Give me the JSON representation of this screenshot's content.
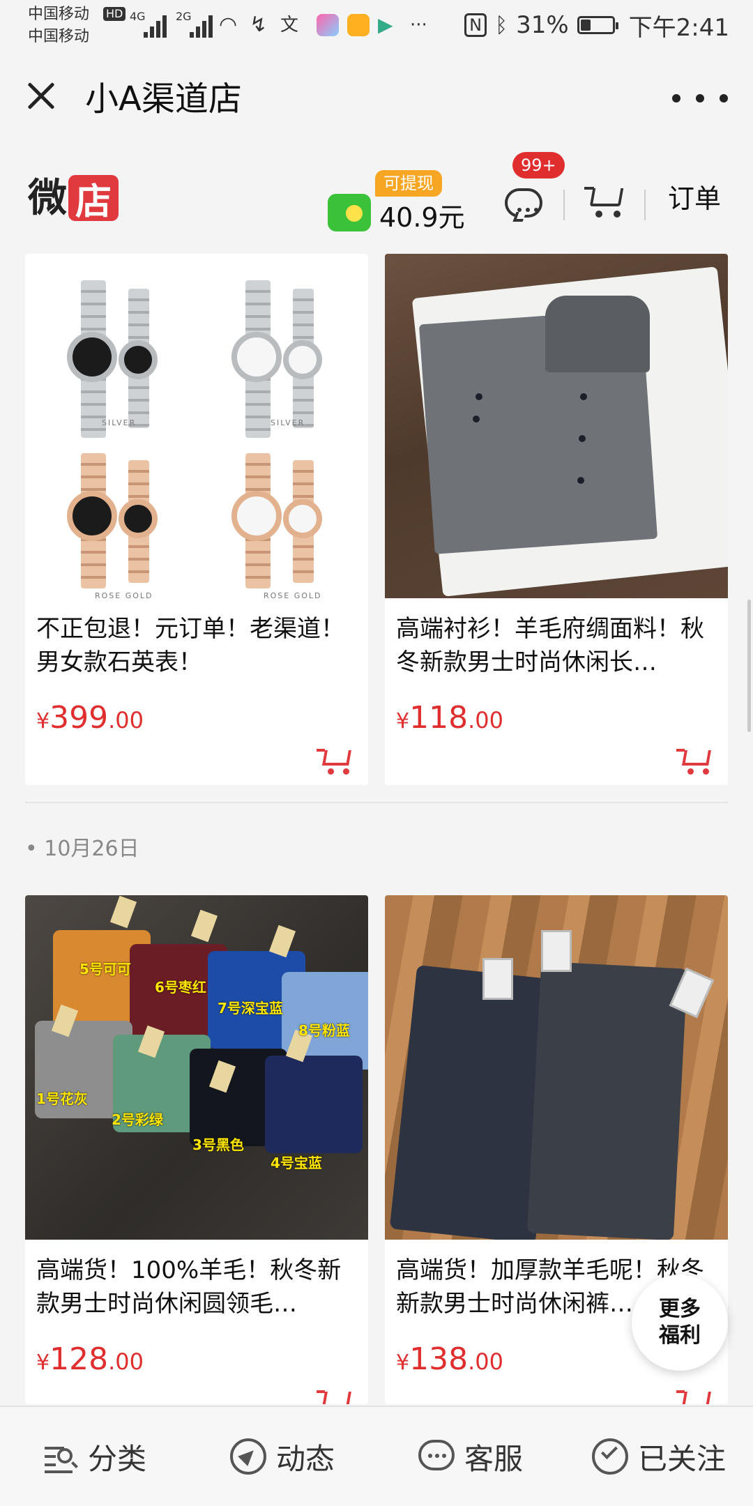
{
  "status_bar": {
    "carrier_1": "中国移动",
    "carrier_2": "中国移动",
    "hd": "HD",
    "net_1": "4G",
    "net_2": "2G",
    "nfc": "N",
    "battery_text": "31%",
    "battery_level": 0.31,
    "time": "下午2:41",
    "icons": [
      "wifi-icon",
      "missed-call-icon",
      "translate-icon",
      "app-icon",
      "app-icon",
      "play-icon",
      "more-notifications-icon",
      "nfc-icon",
      "bluetooth-icon",
      "battery-icon"
    ]
  },
  "title_bar": {
    "title": "小A渠道店"
  },
  "shop_header": {
    "logo_part1": "微",
    "logo_part2": "店",
    "withdraw_badge": "可提现",
    "balance": "40.9元",
    "message_count": "99+",
    "orders_label": "订单"
  },
  "products": [
    {
      "title": "不正包退！元订单！老渠道！男女款石英表！",
      "currency": "¥",
      "price_int": "399",
      "price_dec": ".00",
      "image": "watches-photo"
    },
    {
      "title": "高端衬衫！羊毛府绸面料！秋冬新款男士时尚休闲长…",
      "currency": "¥",
      "price_int": "118",
      "price_dec": ".00",
      "image": "shirts-photo"
    },
    {
      "title": "高端货！100%羊毛！秋冬新款男士时尚休闲圆领毛…",
      "currency": "¥",
      "price_int": "128",
      "price_dec": ".00",
      "image": "sweaters-photo"
    },
    {
      "title": "高端货！加厚款羊毛呢！秋冬新款男士时尚休闲裤…",
      "currency": "¥",
      "price_int": "138",
      "price_dec": ".00",
      "image": "pants-photo"
    }
  ],
  "watch_labels": {
    "silver": "SILVER",
    "rose": "ROSE GOLD"
  },
  "sweater_labels": [
    "5号可可",
    "6号枣红",
    "7号深宝蓝",
    "8号粉蓝",
    "1号花灰",
    "2号彩绿",
    "3号黑色",
    "4号宝蓝"
  ],
  "section": {
    "date": "• 10月26日"
  },
  "fab": {
    "line1": "更多",
    "line2": "福利"
  },
  "bottom_nav": {
    "category": "分类",
    "feed": "动态",
    "service": "客服",
    "follow": "已关注"
  }
}
